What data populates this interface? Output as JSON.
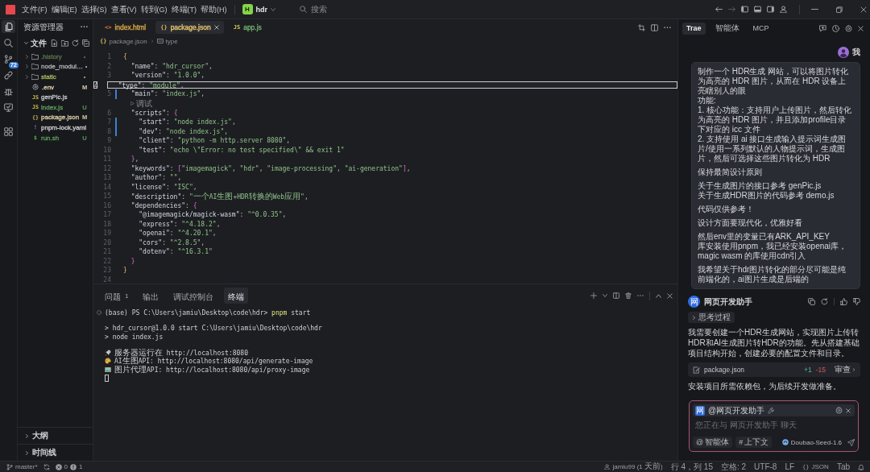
{
  "title_bar": {
    "menus": [
      "文件(F)",
      "编辑(E)",
      "选择(S)",
      "查看(V)",
      "转到(G)",
      "终端(T)",
      "帮助(H)"
    ],
    "project": {
      "badge": "H",
      "name": "hdr"
    },
    "search": {
      "placeholder": "搜索"
    }
  },
  "activity_bar": {
    "items": [
      {
        "kind": "files",
        "selected": true
      },
      {
        "kind": "search",
        "selected": false
      },
      {
        "kind": "source-control",
        "selected": false,
        "badge": "72"
      },
      {
        "kind": "link",
        "selected": false
      },
      {
        "kind": "bug",
        "selected": false
      },
      {
        "kind": "monitor",
        "selected": false
      },
      {
        "kind": "extensions",
        "selected": false
      }
    ]
  },
  "explorer": {
    "title": "资源管理器",
    "section": {
      "label": "文件",
      "expanded": true
    },
    "items": [
      {
        "name": ".history",
        "kind": "folder",
        "expanded": false,
        "status": "•",
        "color": "#56734b"
      },
      {
        "name": "node_modul…",
        "kind": "folder",
        "expanded": false,
        "status": "•",
        "color": "#a9abb0"
      },
      {
        "name": "static",
        "kind": "folder",
        "expanded": false,
        "status": "•",
        "color": "#a3b25a"
      },
      {
        "name": ".env",
        "kind": "settings",
        "status": "M",
        "color": "#d5cba5"
      },
      {
        "name": "genPic.js",
        "kind": "js",
        "glyph": "JS",
        "color": "#c8c9cc"
      },
      {
        "name": "index.js",
        "kind": "js",
        "glyph": "JS",
        "status": "U",
        "color": "#5c9a5c"
      },
      {
        "name": "package.json",
        "kind": "json",
        "glyph": "{}",
        "status": "M",
        "color": "#d5cba5"
      },
      {
        "name": "pnpm-lock.yaml",
        "kind": "yaml",
        "glyph": "!",
        "color": "#c8c9cc"
      },
      {
        "name": "run.sh",
        "kind": "shell",
        "glyph": "$",
        "status": "U",
        "color": "#5c9a5c"
      }
    ],
    "bottom_sections": [
      {
        "label": "大纲",
        "expanded": false
      },
      {
        "label": "时间线",
        "expanded": false
      }
    ]
  },
  "editor": {
    "tabs": [
      {
        "label": "index.html",
        "kind": "html",
        "glyph": "<>",
        "selected": false,
        "color": "#d8a845"
      },
      {
        "label": "package.json",
        "kind": "json",
        "glyph": "{}",
        "selected": true,
        "color": "#e3c56c"
      },
      {
        "label": "app.js",
        "kind": "js",
        "glyph": "JS",
        "selected": false,
        "color": "#6fae6f"
      }
    ],
    "breadcrumb": [
      {
        "kind": "json",
        "glyph": "{}",
        "label": "package.json"
      },
      {
        "kind": "property",
        "label": "type"
      }
    ],
    "lines": [
      {
        "kind": "code",
        "number": "1",
        "text": "{",
        "current": false,
        "changed": false
      },
      {
        "kind": "code",
        "number": "2",
        "text": "  \"name\": \"hdr_cursor\",",
        "current": false,
        "changed": false
      },
      {
        "kind": "code",
        "number": "3",
        "text": "  \"version\": \"1.0.0\",",
        "current": false,
        "changed": false
      },
      {
        "kind": "code",
        "number": "4",
        "text": "  \"type\": \"module\",",
        "current": true,
        "changed": false
      },
      {
        "kind": "code",
        "number": "5",
        "text": "  \"main\": \"index.js\",",
        "current": false,
        "changed": true
      },
      {
        "kind": "codelens",
        "text": "调试"
      },
      {
        "kind": "code",
        "number": "6",
        "text": "  \"scripts\": {",
        "current": false,
        "changed": false
      },
      {
        "kind": "code",
        "number": "7",
        "text": "    \"start\": \"node index.js\",",
        "current": false,
        "changed": true
      },
      {
        "kind": "code",
        "number": "8",
        "text": "    \"dev\": \"node index.js\",",
        "current": false,
        "changed": true
      },
      {
        "kind": "code",
        "number": "9",
        "text": "    \"client\": \"python -m http.server 8080\",",
        "current": false,
        "changed": false
      },
      {
        "kind": "code",
        "number": "10",
        "text": "    \"test\": \"echo \\\"Error: no test specified\\\" && exit 1\"",
        "current": false,
        "changed": false
      },
      {
        "kind": "code",
        "number": "11",
        "text": "  },",
        "current": false,
        "changed": false
      },
      {
        "kind": "code",
        "number": "12",
        "text": "  \"keywords\": [\"imagemagick\", \"hdr\", \"image-processing\", \"ai-generation\"],",
        "current": false,
        "changed": false
      },
      {
        "kind": "code",
        "number": "13",
        "text": "  \"author\": \"\",",
        "current": false,
        "changed": false
      },
      {
        "kind": "code",
        "number": "14",
        "text": "  \"license\": \"ISC\",",
        "current": false,
        "changed": false
      },
      {
        "kind": "code",
        "number": "15",
        "text": "  \"description\": \"一个AI生图+HDR转换的Web应用\",",
        "current": false,
        "changed": false
      },
      {
        "kind": "code",
        "number": "16",
        "text": "  \"dependencies\": {",
        "current": false,
        "changed": false
      },
      {
        "kind": "code",
        "number": "17",
        "text": "    \"@imagemagick/magick-wasm\": \"^0.0.35\",",
        "current": false,
        "changed": false
      },
      {
        "kind": "code",
        "number": "18",
        "text": "    \"express\": \"^4.18.2\",",
        "current": false,
        "changed": false
      },
      {
        "kind": "code",
        "number": "19",
        "text": "    \"openai\": \"^4.20.1\",",
        "current": false,
        "changed": false
      },
      {
        "kind": "code",
        "number": "20",
        "text": "    \"cors\": \"^2.8.5\",",
        "current": false,
        "changed": false
      },
      {
        "kind": "code",
        "number": "21",
        "text": "    \"dotenv\": \"^16.3.1\"",
        "current": false,
        "changed": false
      },
      {
        "kind": "code",
        "number": "22",
        "text": "  }",
        "current": false,
        "changed": false
      },
      {
        "kind": "code",
        "number": "23",
        "text": "}",
        "current": false,
        "changed": false
      },
      {
        "kind": "code",
        "number": "24",
        "current": false,
        "changed": false
      }
    ]
  },
  "panel": {
    "tabs": [
      {
        "label": "问题",
        "count": "1",
        "selected": false
      },
      {
        "label": "输出",
        "selected": false
      },
      {
        "label": "调试控制台",
        "selected": false
      },
      {
        "label": "终端",
        "selected": true
      }
    ],
    "terminal": {
      "blocks": [
        [
          {
            "kind": "prompt",
            "text": "(base) PS C:\\Users\\jamiu\\Desktop\\code\\hdr>",
            "command": "pnpm",
            "args": "start"
          }
        ],
        [
          {
            "kind": "output",
            "text": "> hdr_cursor@1.0.0 start C:\\Users\\jamiu\\Desktop\\code\\hdr"
          },
          {
            "kind": "output",
            "text": "> node index.js"
          }
        ],
        [
          {
            "kind": "emoji",
            "text": "服务器运行在 http://localhost:8080"
          },
          {
            "kind": "emoji",
            "text": "AI生图API: http://localhost:8080/api/generate-image"
          },
          {
            "kind": "emoji",
            "text": "图片代理API: http://localhost:8080/api/proxy-image"
          },
          {
            "kind": "cursor"
          }
        ]
      ]
    }
  },
  "chat": {
    "tabs": [
      {
        "label": "Trae",
        "selected": true
      },
      {
        "label": "智能体",
        "selected": false
      },
      {
        "label": "MCP",
        "selected": false
      }
    ],
    "messages": [
      {
        "kind": "user",
        "name": "我",
        "blocks": [
          [
            "制作一个 HDR生成 网站，可以将图片转化为高亮的 HDR 图片，从而在 HDR 设备上亮瞎别人的眼",
            "功能:",
            "1. 核心功能：支持用户上传图片，然后转化为高亮的 HDR 图片，并且添加profile目录下对应的 icc 文件",
            "2. 支持使用 ai 接口生成输入提示词生成图片/使用一系列默认的人物提示词，生成图片，然后可选择这些图片转化为 HDR"
          ],
          [
            "保持最简设计原则"
          ],
          [
            "关于生成图片的接口参考 genPic.js",
            "关于生成HDR图片的代码参考 demo.js"
          ],
          [
            "代码仅供参考！"
          ],
          [
            "设计方面要现代化，优雅好看"
          ],
          [
            "然后env里的变量已有ARK_API_KEY",
            "库安装使用pnpm，我已经安装openai库，magic wasm 的库使用cdn引入"
          ],
          [
            "我希望关于hdr图片转化的部分尽可能是纯前端化的，ai图片生成是后端的"
          ]
        ]
      },
      {
        "kind": "assistant",
        "avatar": "网",
        "name": "网页开发助手",
        "thinking": {
          "label": "思考过程",
          "expanded": false
        },
        "parts": [
          {
            "kind": "text",
            "text": "我需要创建一个HDR生成网站，实现图片上传转HDR和AI生成图片转HDR的功能。先从搭建基础项目结构开始，创建必要的配置文件和目录。"
          },
          {
            "kind": "file",
            "name": "package.json",
            "added": "+1",
            "removed": "-15",
            "action": "审查"
          },
          {
            "kind": "text",
            "text": "安装项目所需依赖包，为后续开发做准备。"
          }
        ]
      }
    ],
    "input": {
      "agent": {
        "avatar": "网",
        "label": "@网页开发助手"
      },
      "placeholder": "您正在与 网页开发助手 聊天",
      "chips": [
        {
          "symbol": "@",
          "label": "智能体"
        },
        {
          "symbol": "#",
          "label": "上下文"
        }
      ],
      "model": "Doubao-Seed-1.6"
    }
  },
  "status_bar": {
    "left": {
      "branch": "master*",
      "errors": "0",
      "warnings": "1"
    },
    "right": [
      {
        "kind": "blame",
        "text": "jamiu99 (1 天前)"
      },
      {
        "kind": "text",
        "text": "行 4，列 15"
      },
      {
        "kind": "text",
        "text": "空格: 2"
      },
      {
        "kind": "text",
        "text": "UTF-8"
      },
      {
        "kind": "text",
        "text": "LF"
      },
      {
        "kind": "language",
        "glyph": "{}",
        "text": "JSON"
      },
      {
        "kind": "text",
        "text": "Tab"
      },
      {
        "kind": "notifications"
      }
    ]
  }
}
